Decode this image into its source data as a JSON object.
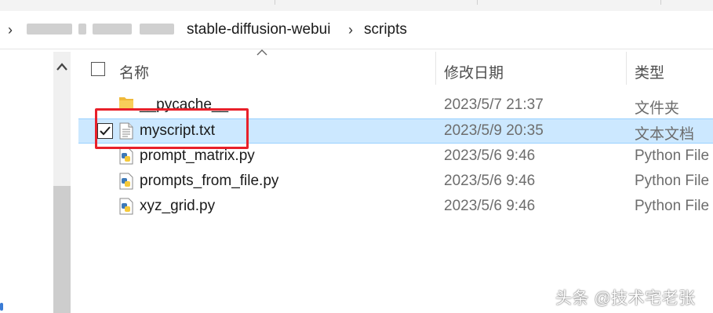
{
  "breadcrumb": {
    "items": [
      "stable-diffusion-webui",
      "scripts"
    ]
  },
  "columns": {
    "name": "名称",
    "date": "修改日期",
    "type": "类型"
  },
  "files": [
    {
      "name": "__pycache__",
      "date": "2023/5/7 21:37",
      "type": "文件夹",
      "icon": "folder-icon"
    },
    {
      "name": "myscript.txt",
      "date": "2023/5/9 20:35",
      "type": "文本文档",
      "icon": "text-file-icon",
      "selected": true
    },
    {
      "name": "prompt_matrix.py",
      "date": "2023/5/6 9:46",
      "type": "Python File",
      "icon": "python-file-icon"
    },
    {
      "name": "prompts_from_file.py",
      "date": "2023/5/6 9:46",
      "type": "Python File",
      "icon": "python-file-icon"
    },
    {
      "name": "xyz_grid.py",
      "date": "2023/5/6 9:46",
      "type": "Python File",
      "icon": "python-file-icon"
    }
  ],
  "watermark": "头条 @技术宅老张",
  "colors": {
    "selection": "#cce8ff",
    "highlight": "#e8202a"
  }
}
